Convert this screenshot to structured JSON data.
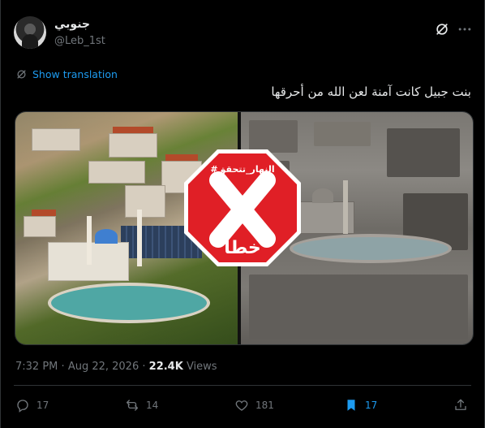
{
  "author": {
    "display_name": "جنوبي",
    "handle": "@Leb_1st"
  },
  "translate": {
    "label": "Show translation"
  },
  "tweet": {
    "text": "بنت جبيل كانت آمنة لعن الله من أحرقها"
  },
  "media": {
    "stamp": {
      "tag": "#النهار_تتحقق",
      "verdict": "خطأ",
      "color": "#e01f26"
    }
  },
  "meta": {
    "time": "7:32 PM",
    "date": "Aug 22, 2026",
    "views_count": "22.4K",
    "views_label": "Views",
    "separator": "·"
  },
  "actions": {
    "replies": "17",
    "reposts": "14",
    "likes": "181",
    "bookmarks": "17"
  },
  "colors": {
    "accent": "#1d9bf0",
    "muted": "#71767b",
    "text": "#e7e9ea",
    "background": "#000000"
  }
}
